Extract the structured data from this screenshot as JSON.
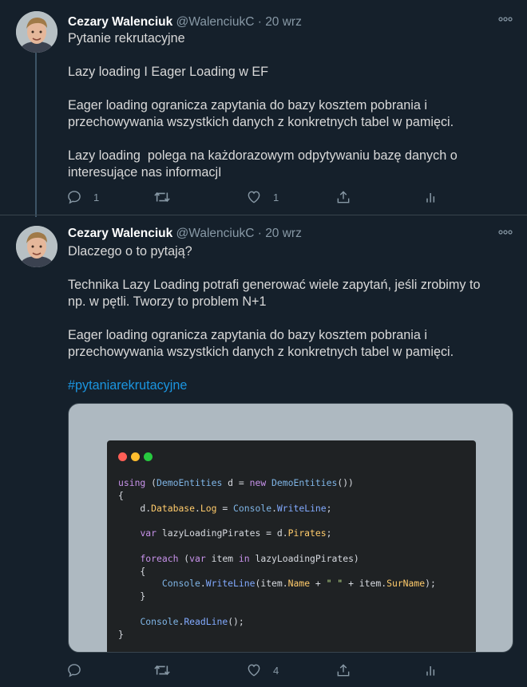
{
  "tweet1": {
    "name": "Cezary Walenciuk",
    "handle": "@WalenciukC",
    "sep": " · ",
    "date": "20 wrz",
    "text": "Pytanie rekrutacyjne\n\nLazy loading I Eager Loading w EF\n\nEager loading ogranicza zapytania do bazy kosztem pobrania i przechowywania wszystkich danych z konkretnych tabel w pamięci.\n\nLazy loading  polega na każdorazowym odpytywaniu bazę danych o interesujące nas informacjI",
    "replies": "1",
    "retweets": "",
    "likes": "1"
  },
  "tweet2": {
    "name": "Cezary Walenciuk",
    "handle": "@WalenciukC",
    "sep": " · ",
    "date": "20 wrz",
    "text": "Dlaczego o to pytają?\n\nTechnika Lazy Loading potrafi generować wiele zapytań, jeśli zrobimy to np. w pętli. Tworzy to problem N+1\n\nEager loading ogranicza zapytania do bazy kosztem pobrania i przechowywania wszystkich danych z konkretnych tabel w pamięci.",
    "hashtag": "#pytaniarekrutacyjne",
    "replies": "",
    "retweets": "",
    "likes": "4"
  },
  "code_image": {
    "window_dots": [
      "#ff5f56",
      "#ffbd2e",
      "#27c93f"
    ],
    "lines": [
      "using (DemoEntities d = new DemoEntities())",
      "{",
      "    d.Database.Log = Console.WriteLine;",
      "",
      "    var lazyLoadingPirates = d.Pirates;",
      "",
      "    foreach (var item in lazyLoadingPirates)",
      "    {",
      "        Console.WriteLine(item.Name + \" \" + item.SurName);",
      "    }",
      "",
      "    Console.ReadLine();",
      "}"
    ]
  },
  "icons": [
    "reply-icon",
    "retweet-icon",
    "like-icon",
    "share-icon",
    "analytics-icon",
    "more-icon"
  ],
  "colors": {
    "background": "#15202b",
    "text": "#d9d9d9",
    "muted": "#8899a6",
    "hashtag": "#1b95e0",
    "divider": "#38444d"
  }
}
